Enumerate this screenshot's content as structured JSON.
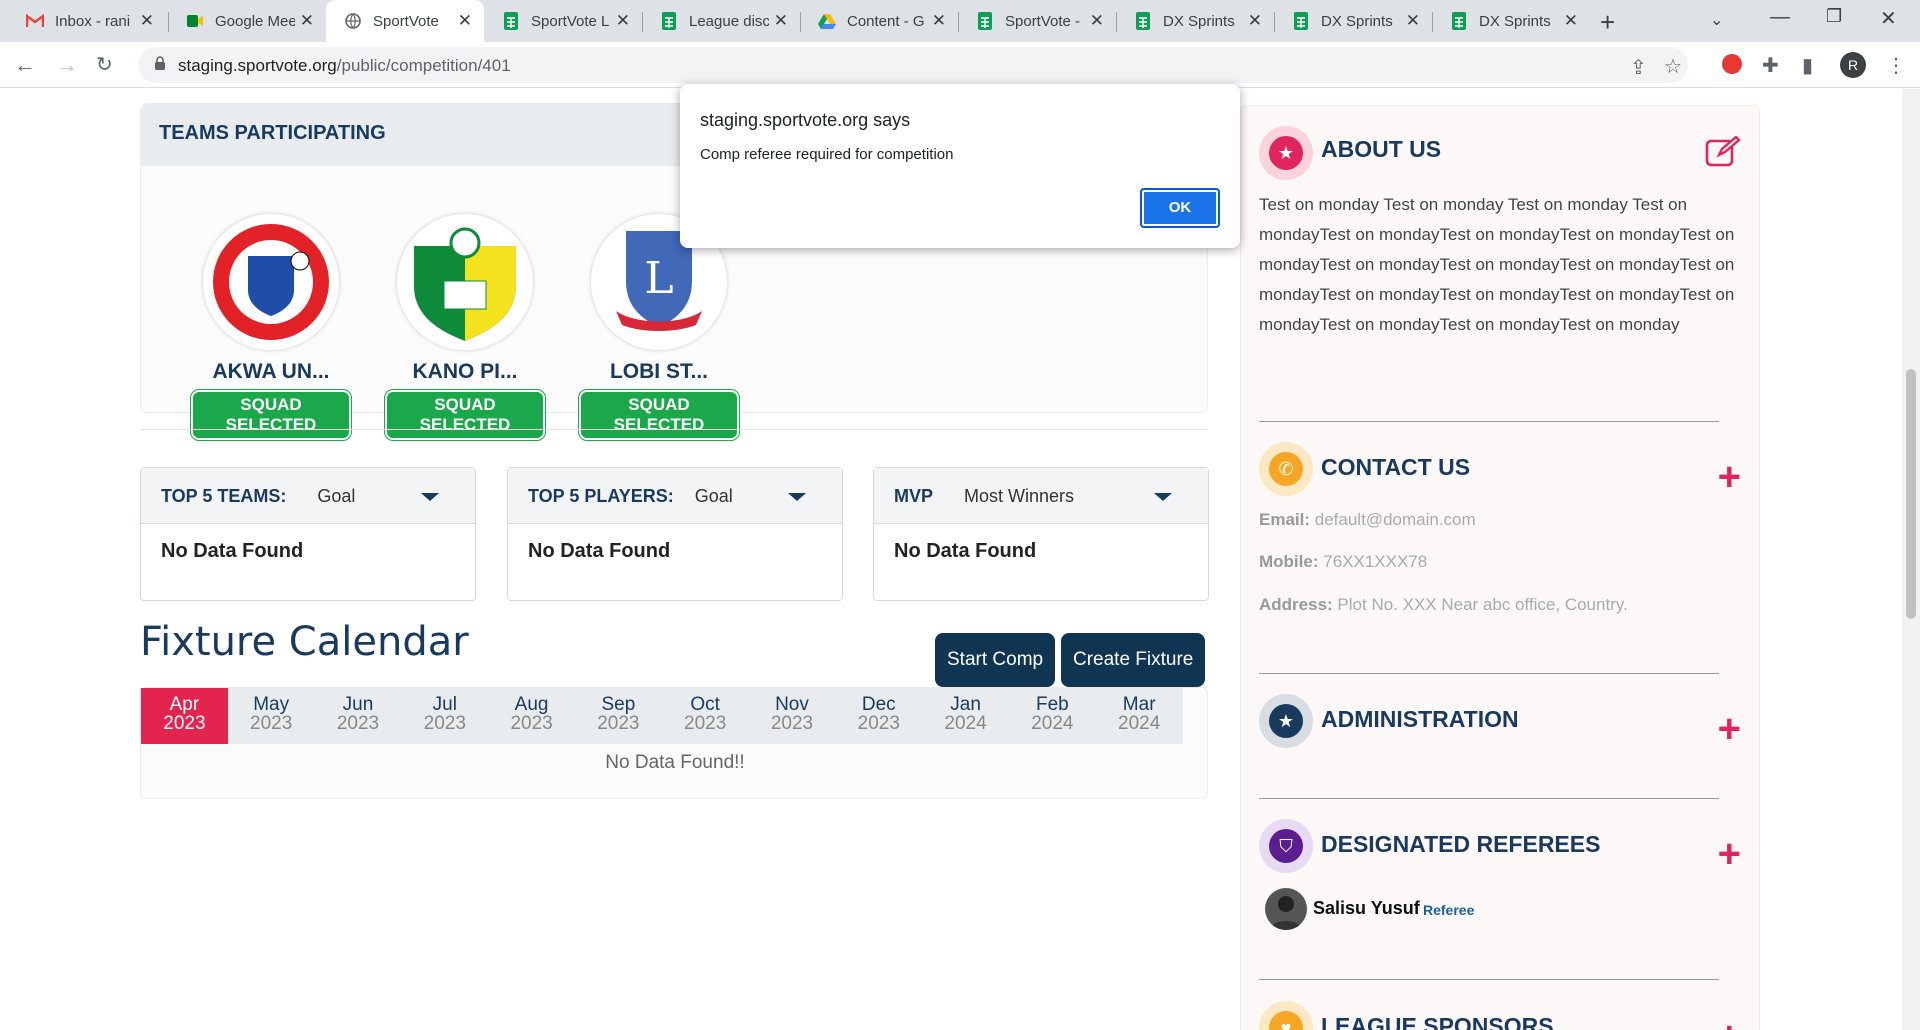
{
  "browser": {
    "tabs": [
      {
        "title": "Inbox - rani",
        "icon": "gmail-icon"
      },
      {
        "title": "Google Mee",
        "icon": "meet-icon"
      },
      {
        "title": "SportVote",
        "icon": "globe-icon"
      },
      {
        "title": "SportVote L",
        "icon": "sheets-icon"
      },
      {
        "title": "League disc",
        "icon": "sheets-icon"
      },
      {
        "title": "Content - G",
        "icon": "drive-icon"
      },
      {
        "title": "SportVote -",
        "icon": "sheets-icon"
      },
      {
        "title": "DX Sprints",
        "icon": "sheets-icon"
      },
      {
        "title": "DX Sprints",
        "icon": "sheets-icon"
      },
      {
        "title": "DX Sprints",
        "icon": "sheets-icon"
      }
    ],
    "url_host": "staging.sportvote.org",
    "url_path": "/public/competition/401",
    "profile_initial": "R"
  },
  "teams": {
    "header": "TEAMS PARTICIPATING",
    "items": [
      {
        "name": "AKWA UN...",
        "status": "SQUAD SELECTED"
      },
      {
        "name": "KANO PI...",
        "status": "SQUAD SELECTED"
      },
      {
        "name": "LOBI ST...",
        "status": "SQUAD SELECTED"
      }
    ]
  },
  "stats": [
    {
      "label": "TOP 5 TEAMS:",
      "selected": "Goal",
      "empty": "No Data Found"
    },
    {
      "label": "TOP 5 PLAYERS:",
      "selected": "Goal",
      "empty": "No Data Found"
    },
    {
      "label": "MVP",
      "selected": "Most Winners",
      "empty": "No Data Found"
    }
  ],
  "fixture": {
    "title": "Fixture Calendar",
    "start_button": "Start Comp",
    "create_button": "Create Fixture",
    "months": [
      {
        "m": "Apr",
        "y": "2023",
        "active": true
      },
      {
        "m": "May",
        "y": "2023"
      },
      {
        "m": "Jun",
        "y": "2023"
      },
      {
        "m": "Jul",
        "y": "2023"
      },
      {
        "m": "Aug",
        "y": "2023"
      },
      {
        "m": "Sep",
        "y": "2023"
      },
      {
        "m": "Oct",
        "y": "2023"
      },
      {
        "m": "Nov",
        "y": "2023"
      },
      {
        "m": "Dec",
        "y": "2023"
      },
      {
        "m": "Jan",
        "y": "2024"
      },
      {
        "m": "Feb",
        "y": "2024"
      },
      {
        "m": "Mar",
        "y": "2024"
      }
    ],
    "empty": "No Data Found!!"
  },
  "sidebar": {
    "about": {
      "title": "ABOUT US",
      "text": "Test on monday Test on monday Test on monday Test on mondayTest on mondayTest on mondayTest on mondayTest on mondayTest on mondayTest on mondayTest on mondayTest on mondayTest on mondayTest on mondayTest on mondayTest on mondayTest on mondayTest on mondayTest on monday"
    },
    "contact": {
      "title": "CONTACT US",
      "email_label": "Email:",
      "email": "default@domain.com",
      "mobile_label": "Mobile:",
      "mobile": "76XX1XXX78",
      "address_label": "Address:",
      "address": "Plot No. XXX Near abc office, Country."
    },
    "administration": {
      "title": "ADMINISTRATION"
    },
    "referees": {
      "title": "DESIGNATED REFEREES",
      "name": "Salisu Yusuf",
      "role": "Referee"
    },
    "sponsors": {
      "title": "LEAGUE SPONSORS"
    }
  },
  "dialog": {
    "title": "staging.sportvote.org says",
    "message": "Comp referee required for competition",
    "ok": "OK"
  }
}
